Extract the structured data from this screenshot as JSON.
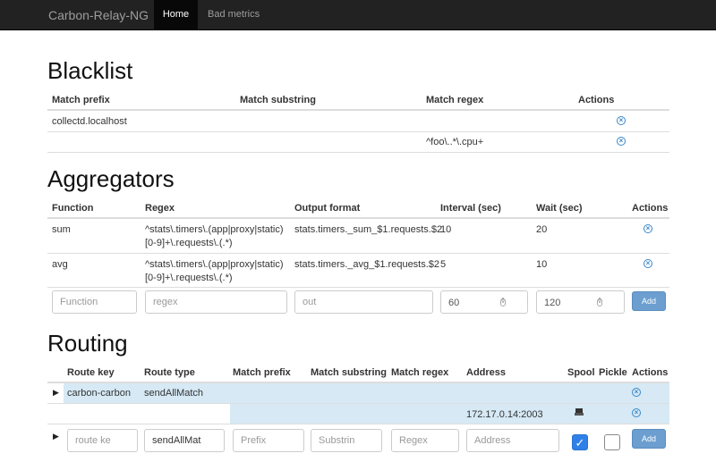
{
  "nav": {
    "brand": "Carbon-Relay-NG",
    "home": "Home",
    "bad_metrics": "Bad metrics"
  },
  "blacklist": {
    "title": "Blacklist",
    "headers": [
      "Match prefix",
      "Match substring",
      "Match regex",
      "Actions"
    ],
    "rows": [
      {
        "prefix": "collectd.localhost",
        "substring": "",
        "regex": ""
      },
      {
        "prefix": "",
        "substring": "",
        "regex": "^foo\\..*\\.cpu+"
      }
    ]
  },
  "aggregators": {
    "title": "Aggregators",
    "headers": [
      "Function",
      "Regex",
      "Output format",
      "Interval (sec)",
      "Wait (sec)",
      "Actions"
    ],
    "rows": [
      {
        "function": "sum",
        "regex_line1": "^stats\\.timers\\.(app|proxy|static)",
        "regex_line2": "[0-9]+\\.requests\\.(.*)",
        "output": "stats.timers._sum_$1.requests.$2",
        "interval": "10",
        "wait": "20"
      },
      {
        "function": "avg",
        "regex_line1": "^stats\\.timers\\.(app|proxy|static)",
        "regex_line2": "[0-9]+\\.requests\\.(.*)",
        "output": "stats.timers._avg_$1.requests.$2",
        "interval": "5",
        "wait": "10"
      }
    ],
    "form": {
      "function_placeholder": "Function",
      "regex_placeholder": "regex",
      "out_placeholder": "out",
      "interval_value": "60",
      "wait_value": "120",
      "add_label": "Add"
    }
  },
  "routing": {
    "title": "Routing",
    "headers": [
      "Route key",
      "Route type",
      "Match prefix",
      "Match substring",
      "Match regex",
      "Address",
      "Spool",
      "Pickle",
      "Actions"
    ],
    "route": {
      "key": "carbon-carbon",
      "type": "sendAllMatch"
    },
    "destination": {
      "address": "172.17.0.14:2003"
    },
    "form": {
      "route_key_placeholder": "route ke",
      "route_type_value": "sendAllMat",
      "prefix_placeholder": "Prefix",
      "substring_placeholder": "Substrin",
      "regex_placeholder": "Regex",
      "address_placeholder": "Address",
      "spool_checked": true,
      "pickle_checked": false,
      "add_label": "Add"
    }
  },
  "colors": {
    "navbar": "#222222",
    "accent": "#3a87c8",
    "row_highlight": "#d6e9f5",
    "add_button": "#6c9fd0"
  }
}
